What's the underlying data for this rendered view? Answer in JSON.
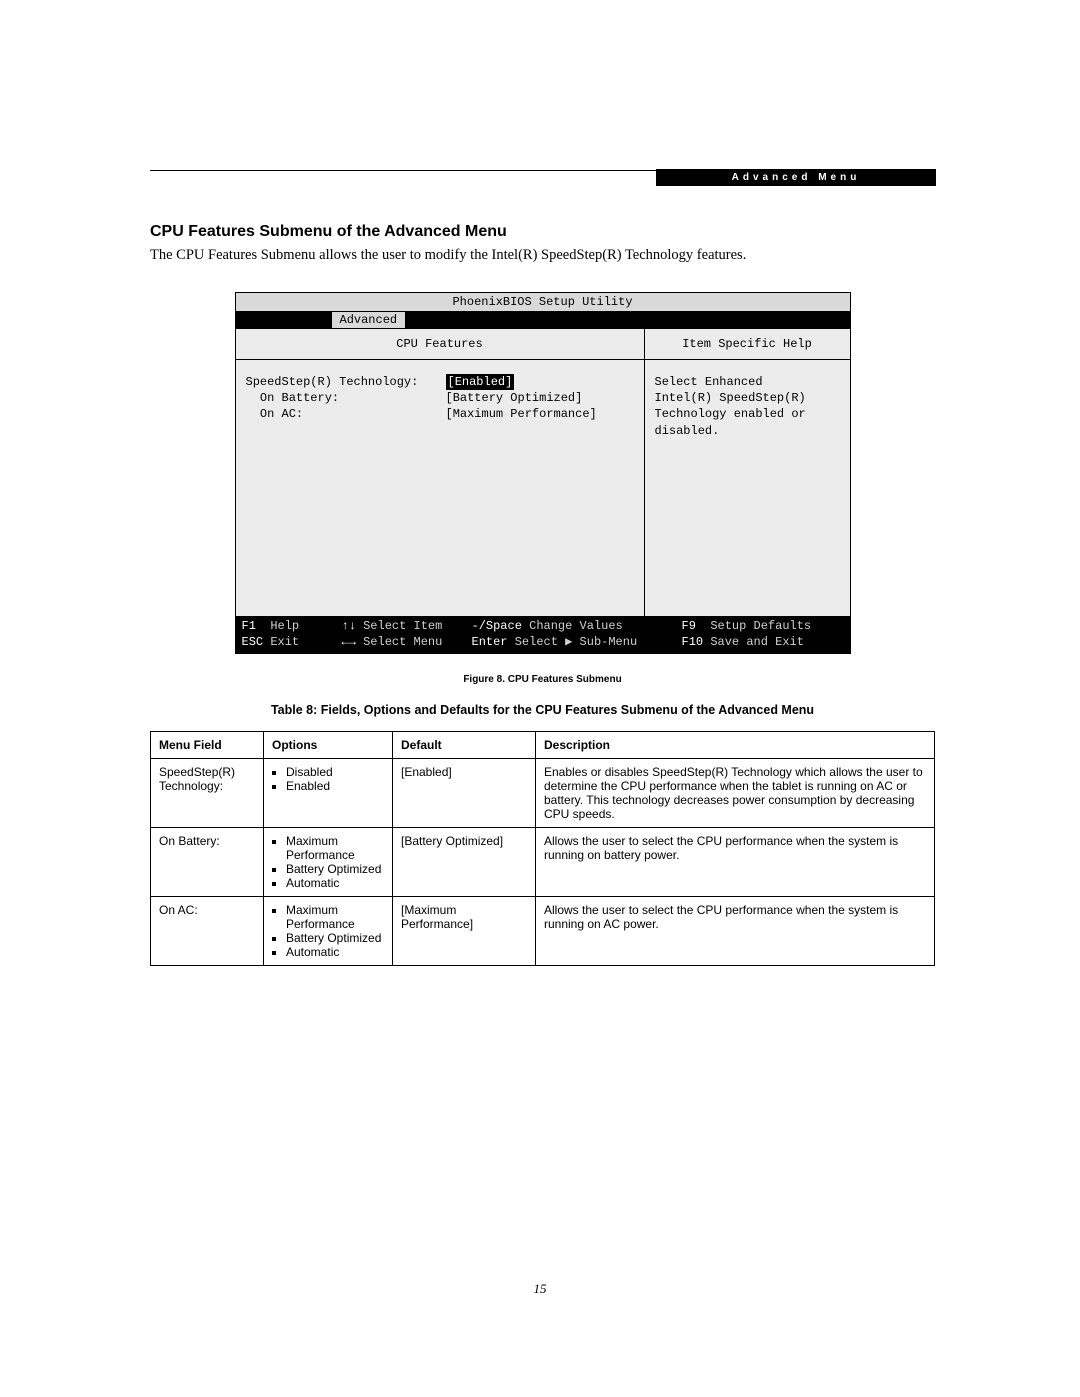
{
  "header_tab": "Advanced Menu",
  "section_title": "CPU Features Submenu of the Advanced Menu",
  "intro": "The CPU Features Submenu allows the user to modify the Intel(R) SpeedStep(R) Technology features.",
  "bios": {
    "title": "PhoenixBIOS Setup Utility",
    "active_tab": "Advanced",
    "left_head": "CPU Features",
    "right_head": "Item Specific Help",
    "settings": [
      {
        "label": "SpeedStep(R) Technology:",
        "value": "[Enabled]",
        "highlight": true
      },
      {
        "label": "  On Battery:",
        "value": "[Battery Optimized]",
        "highlight": false
      },
      {
        "label": "  On AC:",
        "value": "[Maximum Performance]",
        "highlight": false
      }
    ],
    "help_lines": [
      "Select Enhanced",
      "Intel(R) SpeedStep(R)",
      "Technology enabled or",
      "disabled."
    ],
    "footer": {
      "row1": {
        "c1k": "F1",
        "c1t": "Help",
        "c2k": "↑↓",
        "c2t": "Select Item",
        "c3k": "-/Space",
        "c3t": "Change Values",
        "c4k": "F9",
        "c4t": "Setup Defaults"
      },
      "row2": {
        "c1k": "ESC",
        "c1t": "Exit",
        "c2k": "←→",
        "c2t": "Select Menu",
        "c3k": "Enter",
        "c3t": "Select ▶ Sub-Menu",
        "c4k": "F10",
        "c4t": "Save and Exit"
      }
    }
  },
  "figure_caption": "Figure 8.  CPU Features Submenu",
  "table_caption": "Table 8: Fields, Options and Defaults for the CPU Features Submenu of the Advanced Menu",
  "table": {
    "headers": {
      "field": "Menu Field",
      "options": "Options",
      "def": "Default",
      "desc": "Description"
    },
    "rows": [
      {
        "field": "SpeedStep(R) Technology:",
        "options": [
          "Disabled",
          "Enabled"
        ],
        "def": "[Enabled]",
        "desc": "Enables or disables SpeedStep(R) Technology which allows the user to determine the CPU performance when the tablet is running on AC or battery. This technology decreases power consumption by decreasing CPU speeds."
      },
      {
        "field": "On Battery:",
        "options": [
          "Maximum Performance",
          "Battery Optimized",
          "Automatic"
        ],
        "def": "[Battery Optimized]",
        "desc": "Allows the user to select the CPU performance when the system is running on battery power."
      },
      {
        "field": "On AC:",
        "options": [
          "Maximum Performance",
          "Battery Optimized",
          "Automatic"
        ],
        "def": "[Maximum Performance]",
        "desc": "Allows the user to select the CPU performance when the system is running on AC power."
      }
    ]
  },
  "page_number": "15"
}
